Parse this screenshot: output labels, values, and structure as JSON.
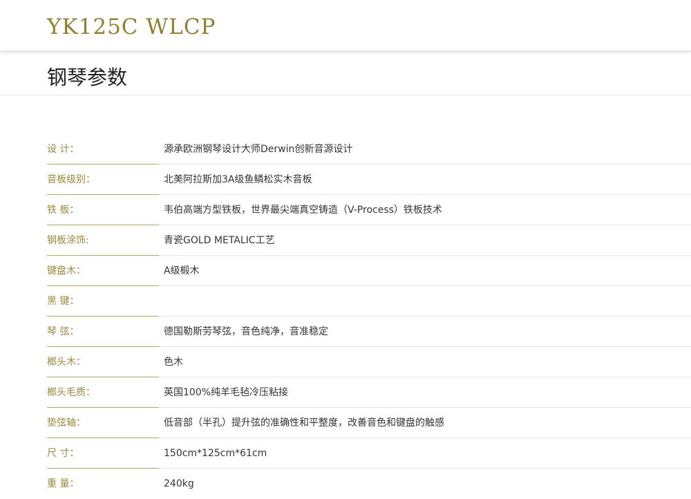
{
  "header": {
    "model": "YK125C WLCP"
  },
  "section": {
    "title": "钢琴参数"
  },
  "colors": {
    "accent": "#8f7f2e",
    "label": "#9a8a3c",
    "text": "#333333"
  },
  "specs": [
    {
      "label": "设 计：",
      "value": "源承欧洲钢琴设计大师Derwin创新音源设计"
    },
    {
      "label": "音板级别：",
      "value": "北美阿拉斯加3A级鱼鳞松实木音板"
    },
    {
      "label": "铁 板：",
      "value": "韦伯高端方型铁板，世界最尖端真空铸造（V-Process）铁板技术"
    },
    {
      "label": "钢板涂饰:",
      "value": "青瓷GOLD METALIC工艺"
    },
    {
      "label": "键盘木：",
      "value": "A级椴木"
    },
    {
      "label": "黑 键：",
      "value": ""
    },
    {
      "label": "琴 弦：",
      "value": "德国勒斯劳琴弦，音色纯净，音准稳定"
    },
    {
      "label": "榔头木：",
      "value": "色木"
    },
    {
      "label": "榔头毛质：",
      "value": "英国100%纯羊毛毡冷压粘接"
    },
    {
      "label": "垫弦轴：",
      "value": "低音部（半孔）提升弦的准确性和平整度，改善音色和键盘的触感"
    },
    {
      "label": "尺 寸：",
      "value": "150cm*125cm*61cm"
    },
    {
      "label": "重 量：",
      "value": "240kg"
    }
  ]
}
